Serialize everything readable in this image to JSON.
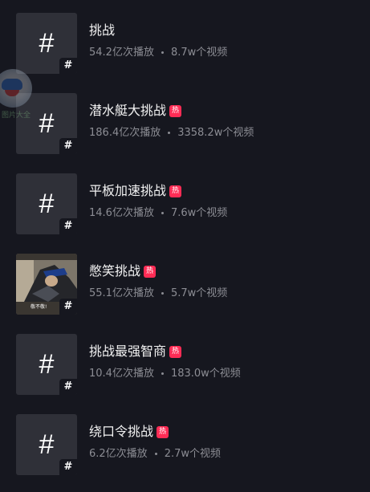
{
  "topics": [
    {
      "title": "挑战",
      "hot": false,
      "views": "54.2亿次播放",
      "videos": "8.7w个视频",
      "thumb": "hash",
      "thumb_symbol": "#"
    },
    {
      "title": "潜水艇大挑战",
      "hot": true,
      "hot_label": "热",
      "views": "186.4亿次播放",
      "videos": "3358.2w个视频",
      "thumb": "hash",
      "thumb_symbol": "#"
    },
    {
      "title": "平板加速挑战",
      "hot": true,
      "hot_label": "热",
      "views": "14.6亿次播放",
      "videos": "7.6w个视频",
      "thumb": "hash",
      "thumb_symbol": "#"
    },
    {
      "title": "憋笑挑战",
      "hot": true,
      "hot_label": "热",
      "views": "55.1亿次播放",
      "videos": "5.7w个视频",
      "thumb": "photo",
      "thumb_symbol": "#",
      "thumb_caption": "敬不敬!"
    },
    {
      "title": "挑战最强智商",
      "hot": true,
      "hot_label": "热",
      "views": "10.4亿次播放",
      "videos": "183.0w个视频",
      "thumb": "hash",
      "thumb_symbol": "#"
    },
    {
      "title": "绕口令挑战",
      "hot": true,
      "hot_label": "热",
      "views": "6.2亿次播放",
      "videos": "2.7w个视频",
      "thumb": "hash",
      "thumb_symbol": "#"
    }
  ],
  "floating_widget": {
    "label": "图片大全",
    "icon": "mascot-icon"
  },
  "colors": {
    "background": "#16171f",
    "thumb_bg": "#2f3038",
    "title": "#f2f2f2",
    "stats": "#8c8d94",
    "hot_badge": "#fe2c55"
  }
}
